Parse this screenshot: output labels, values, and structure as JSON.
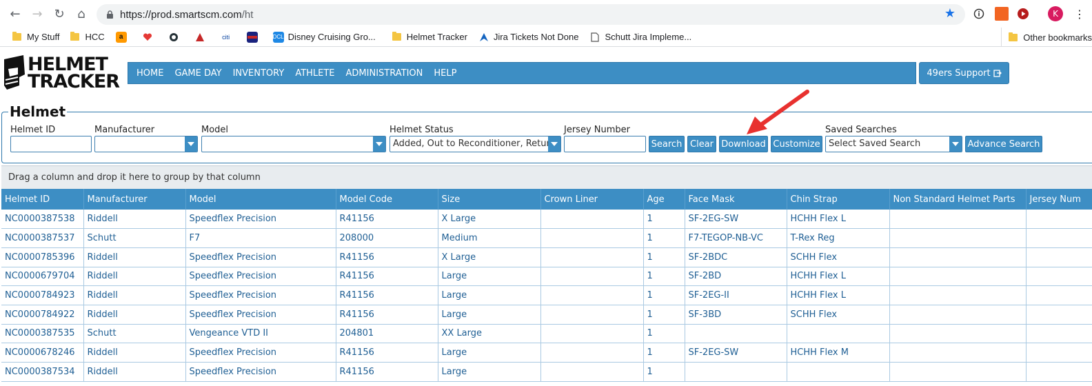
{
  "browser": {
    "url_host": "https://prod.smartscm.com",
    "url_path": "/ht",
    "bookmarks": [
      "My Stuff",
      "HCC",
      "Disney Cruising Gro...",
      "Helmet Tracker",
      "Jira Tickets Not Done",
      "Schutt Jira Impleme..."
    ],
    "other_bookmarks": "Other bookmarks",
    "profile_initial": "K",
    "bookmark_icons": [
      "amazon-icon",
      "heart-icon",
      "shield-icon",
      "delta-icon",
      "citi-icon",
      "flag-icon",
      "disney-icon"
    ]
  },
  "header": {
    "logo_line1": "HELMET",
    "logo_line2": "TRACKER",
    "nav": [
      "HOME",
      "GAME DAY",
      "INVENTORY",
      "ATHLETE",
      "ADMINISTRATION",
      "HELP"
    ],
    "support": "49ers Support"
  },
  "search": {
    "title": "Helmet",
    "labels": {
      "helmet_id": "Helmet ID",
      "manufacturer": "Manufacturer",
      "model": "Model",
      "status": "Helmet Status",
      "jersey": "Jersey Number",
      "saved": "Saved Searches"
    },
    "status_value": "Added, Out to Reconditioner, Return",
    "saved_value": "Select Saved Search",
    "buttons": {
      "search": "Search",
      "clear": "Clear",
      "download": "Download",
      "customize": "Customize",
      "advance": "Advance Search"
    }
  },
  "grid": {
    "group_hint": "Drag a column and drop it here to group by that column",
    "columns": [
      "Helmet ID",
      "Manufacturer",
      "Model",
      "Model Code",
      "Size",
      "Crown Liner",
      "Age",
      "Face Mask",
      "Chin Strap",
      "Non Standard Helmet Parts",
      "Jersey Num"
    ],
    "rows": [
      [
        "NC0000387538",
        "Riddell",
        "Speedflex Precision",
        "R41156",
        "X Large",
        "",
        "1",
        "SF-2EG-SW",
        "HCHH Flex L",
        "",
        ""
      ],
      [
        "NC0000387537",
        "Schutt",
        "F7",
        "208000",
        "Medium",
        "",
        "1",
        "F7-TEGOP-NB-VC",
        "T-Rex Reg",
        "",
        ""
      ],
      [
        "NC0000785396",
        "Riddell",
        "Speedflex Precision",
        "R41156",
        "X Large",
        "",
        "1",
        "SF-2BDC",
        "SCHH Flex",
        "",
        ""
      ],
      [
        "NC0000679704",
        "Riddell",
        "Speedflex Precision",
        "R41156",
        "Large",
        "",
        "1",
        "SF-2BD",
        "HCHH Flex L",
        "",
        ""
      ],
      [
        "NC0000784923",
        "Riddell",
        "Speedflex Precision",
        "R41156",
        "Large",
        "",
        "1",
        "SF-2EG-II",
        "HCHH Flex L",
        "",
        ""
      ],
      [
        "NC0000784922",
        "Riddell",
        "Speedflex Precision",
        "R41156",
        "Large",
        "",
        "1",
        "SF-3BD",
        "SCHH Flex",
        "",
        ""
      ],
      [
        "NC0000387535",
        "Schutt",
        "Vengeance VTD II",
        "204801",
        "XX Large",
        "",
        "1",
        "",
        "",
        "",
        ""
      ],
      [
        "NC0000678246",
        "Riddell",
        "Speedflex Precision",
        "R41156",
        "Large",
        "",
        "1",
        "SF-2EG-SW",
        "HCHH Flex M",
        "",
        ""
      ],
      [
        "NC0000387534",
        "Riddell",
        "Speedflex Precision",
        "R41156",
        "Large",
        "",
        "1",
        "",
        "",
        "",
        ""
      ]
    ]
  },
  "colors": {
    "accent": "#3d8ec4",
    "link_text": "#1f5f94",
    "annotation": "#e8312f"
  }
}
